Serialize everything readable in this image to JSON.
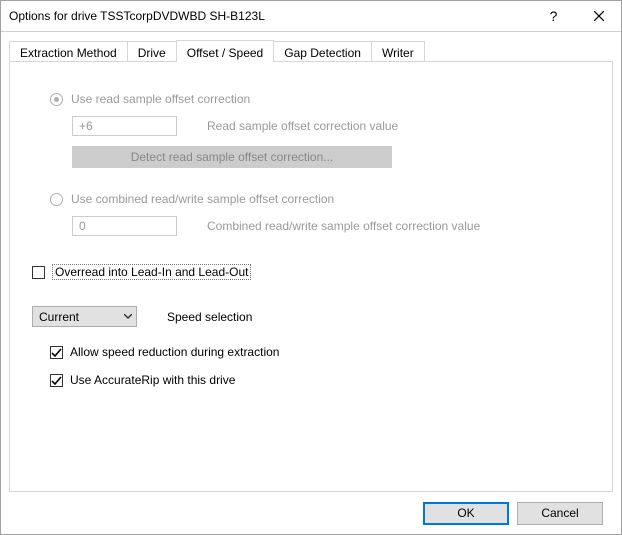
{
  "window": {
    "title": "Options for drive TSSTcorpDVDWBD SH-B123L"
  },
  "tabs": {
    "items": [
      {
        "label": "Extraction Method"
      },
      {
        "label": "Drive"
      },
      {
        "label": "Offset / Speed"
      },
      {
        "label": "Gap Detection"
      },
      {
        "label": "Writer"
      }
    ],
    "active_index": 2
  },
  "panel": {
    "radio_read_label": "Use read sample offset correction",
    "read_value": "+6",
    "read_value_label": "Read sample offset correction value",
    "detect_button": "Detect read sample offset correction...",
    "radio_combined_label": "Use combined read/write sample offset correction",
    "combined_value": "0",
    "combined_value_label": "Combined read/write sample offset correction value",
    "overread_label": "Overread into Lead-In and Lead-Out",
    "speed_dropdown": "Current",
    "speed_label": "Speed selection",
    "allow_speed_reduction": "Allow speed reduction during extraction",
    "use_accuraterip": "Use AccurateRip with this drive"
  },
  "buttons": {
    "ok": "OK",
    "cancel": "Cancel"
  }
}
